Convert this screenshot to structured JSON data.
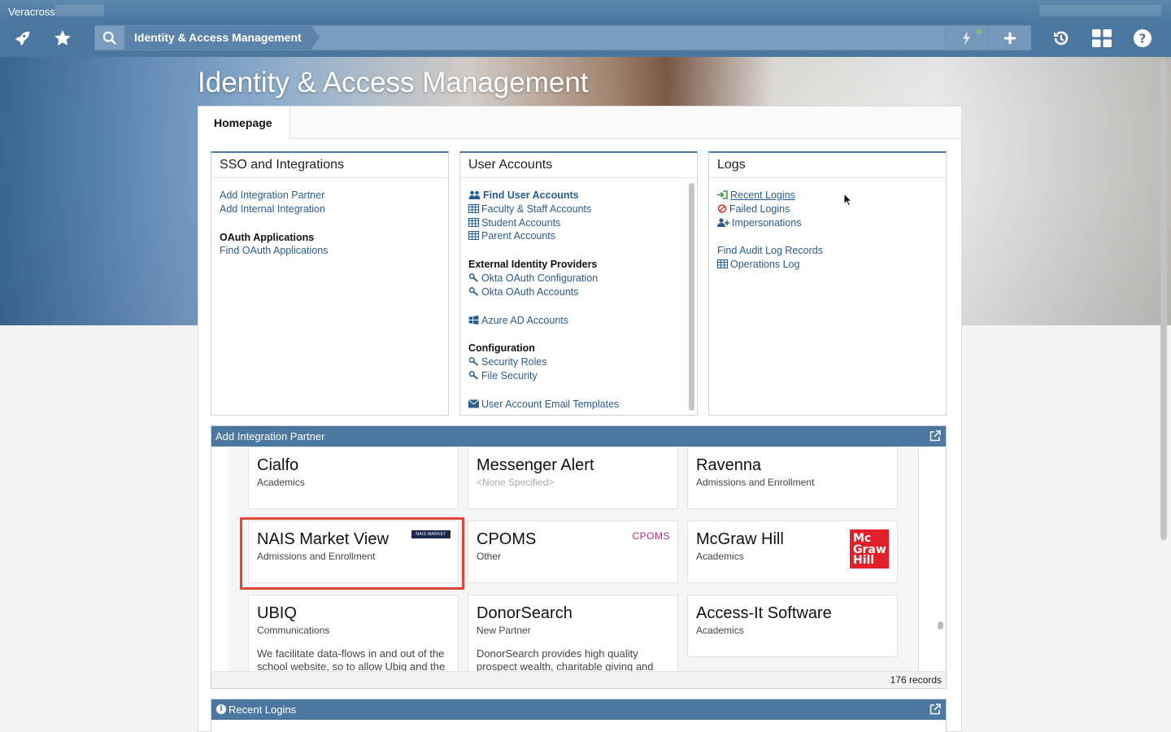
{
  "app": {
    "title": "Veracross"
  },
  "toolbar": {
    "breadcrumb": "Identity & Access Management",
    "icons": [
      "rocket-icon",
      "star-icon",
      "search-icon",
      "bolt-icon",
      "plus-icon",
      "history-icon",
      "grid-icon",
      "help-icon"
    ]
  },
  "hero": {
    "title": "Identity & Access Management"
  },
  "tabs": [
    {
      "label": "Homepage"
    }
  ],
  "panels": {
    "sso": {
      "title": "SSO and Integrations",
      "links": [
        "Add Integration Partner",
        "Add Internal Integration"
      ],
      "oauth_heading": "OAuth Applications",
      "oauth_link": "Find OAuth Applications"
    },
    "users": {
      "title": "User Accounts",
      "find": "Find User Accounts",
      "faculty": "Faculty & Staff Accounts",
      "student": "Student Accounts",
      "parent": "Parent Accounts",
      "ext_heading": "External Identity Providers",
      "okta_config": "Okta OAuth Configuration",
      "okta_accounts": "Okta OAuth Accounts",
      "azure": "Azure AD Accounts",
      "config_heading": "Configuration",
      "roles": "Security Roles",
      "file_security": "File Security",
      "email_templates": "User Account Email Templates"
    },
    "logs": {
      "title": "Logs",
      "recent": "Recent Logins",
      "failed": "Failed Logins",
      "impersonations": "Impersonations",
      "audit": "Find Audit Log Records",
      "operations": "Operations Log"
    }
  },
  "integration_widget": {
    "title": "Add Integration Partner",
    "records": "176 records",
    "tiles": [
      {
        "name": "Cialfo",
        "category": "Academics"
      },
      {
        "name": "Messenger Alert",
        "category": "<None Specified>"
      },
      {
        "name": "Ravenna",
        "category": "Admissions and Enrollment"
      },
      {
        "name": "NAIS Market View",
        "category": "Admissions and Enrollment",
        "logo": "NAIS MARKET VIEW"
      },
      {
        "name": "CPOMS",
        "category": "Other",
        "logo": "CPOMS"
      },
      {
        "name": "McGraw Hill",
        "category": "Academics",
        "logo": "Mc Graw Hill"
      },
      {
        "name": "UBIQ",
        "category": "Communications",
        "description": "We facilitate data-flows in and out of the school website, so to allow Ubiq and the"
      },
      {
        "name": "DonorSearch",
        "category": "New Partner",
        "description": "DonorSearch provides high quality prospect wealth, charitable giving and"
      },
      {
        "name": "Access-It Software",
        "category": "Academics"
      }
    ]
  },
  "recent_widget": {
    "title": "Recent Logins"
  },
  "colors": {
    "brand": "#4c77a0",
    "link": "#2a5c8e",
    "highlight": "#e0473b"
  }
}
